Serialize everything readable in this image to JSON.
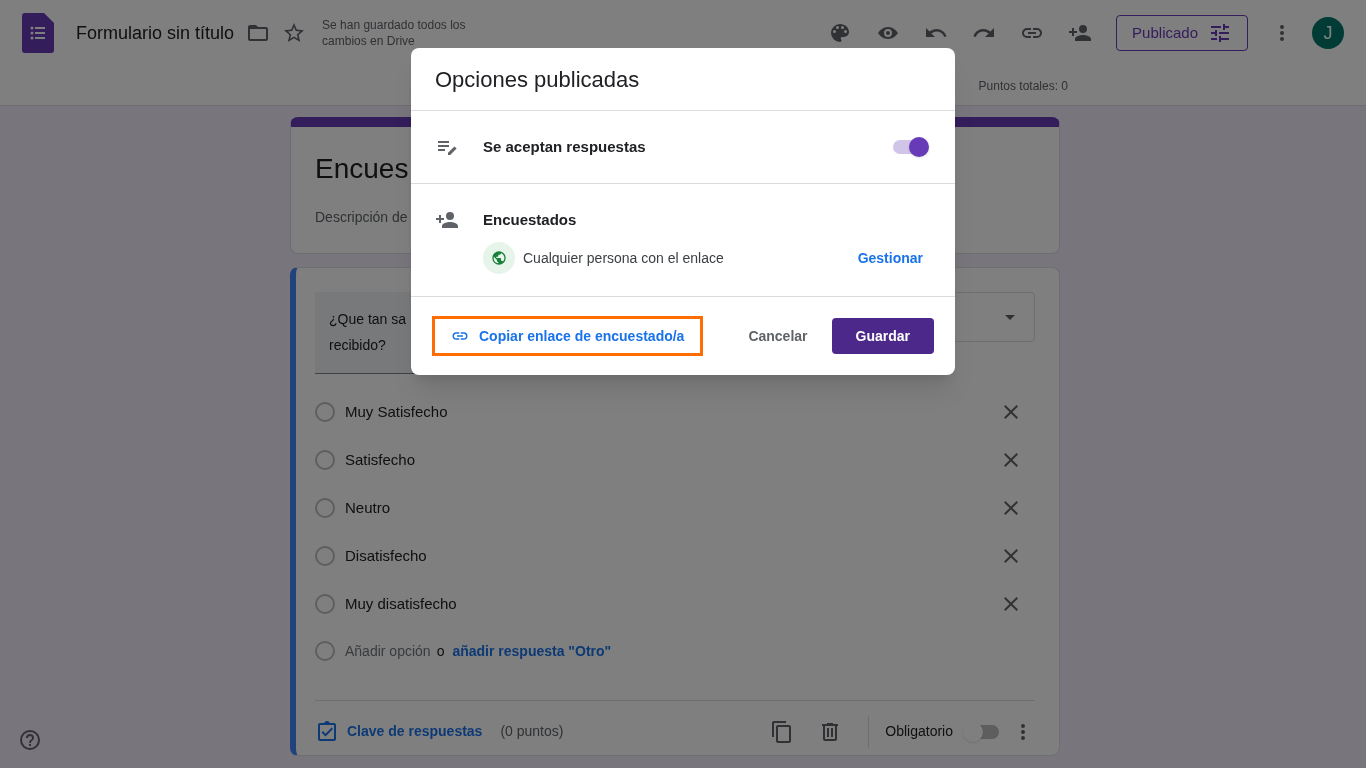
{
  "app": {
    "title": "Formulario sin título",
    "save_status": "Se han guardado todos los cambios en Drive",
    "publish_button": "Publicado",
    "avatar": "J",
    "total_points": "Puntos totales: 0"
  },
  "form_header": {
    "title": "Encues",
    "description": "Descripción de"
  },
  "question": {
    "text_lines": [
      "¿Que tan sa",
      "recibido?"
    ],
    "options": [
      {
        "label": "Muy Satisfecho",
        "selected": false
      },
      {
        "label": "Satisfecho",
        "selected": false
      },
      {
        "label": "Neutro",
        "selected": false
      },
      {
        "label": "Disatisfecho",
        "selected": false
      },
      {
        "label": "Muy disatisfecho",
        "selected": false
      }
    ],
    "add_option_selected": false,
    "add_option": "Añadir opción",
    "or": "o",
    "add_other": "añadir respuesta \"Otro\"",
    "answer_key": "Clave de respuestas",
    "points": "(0 puntos)",
    "required_label": "Obligatorio",
    "required": false
  },
  "dialog": {
    "title": "Opciones publicadas",
    "accepting": {
      "label": "Se aceptan respuestas",
      "on": true
    },
    "respondents": {
      "label": "Encuestados",
      "access": "Cualquier persona con el enlace",
      "manage": "Gestionar"
    },
    "copy_link": {
      "label": "Copiar enlace de encuestado/a",
      "highlighted": true
    },
    "buttons": {
      "cancel": "Cancelar",
      "save": "Guardar"
    }
  }
}
